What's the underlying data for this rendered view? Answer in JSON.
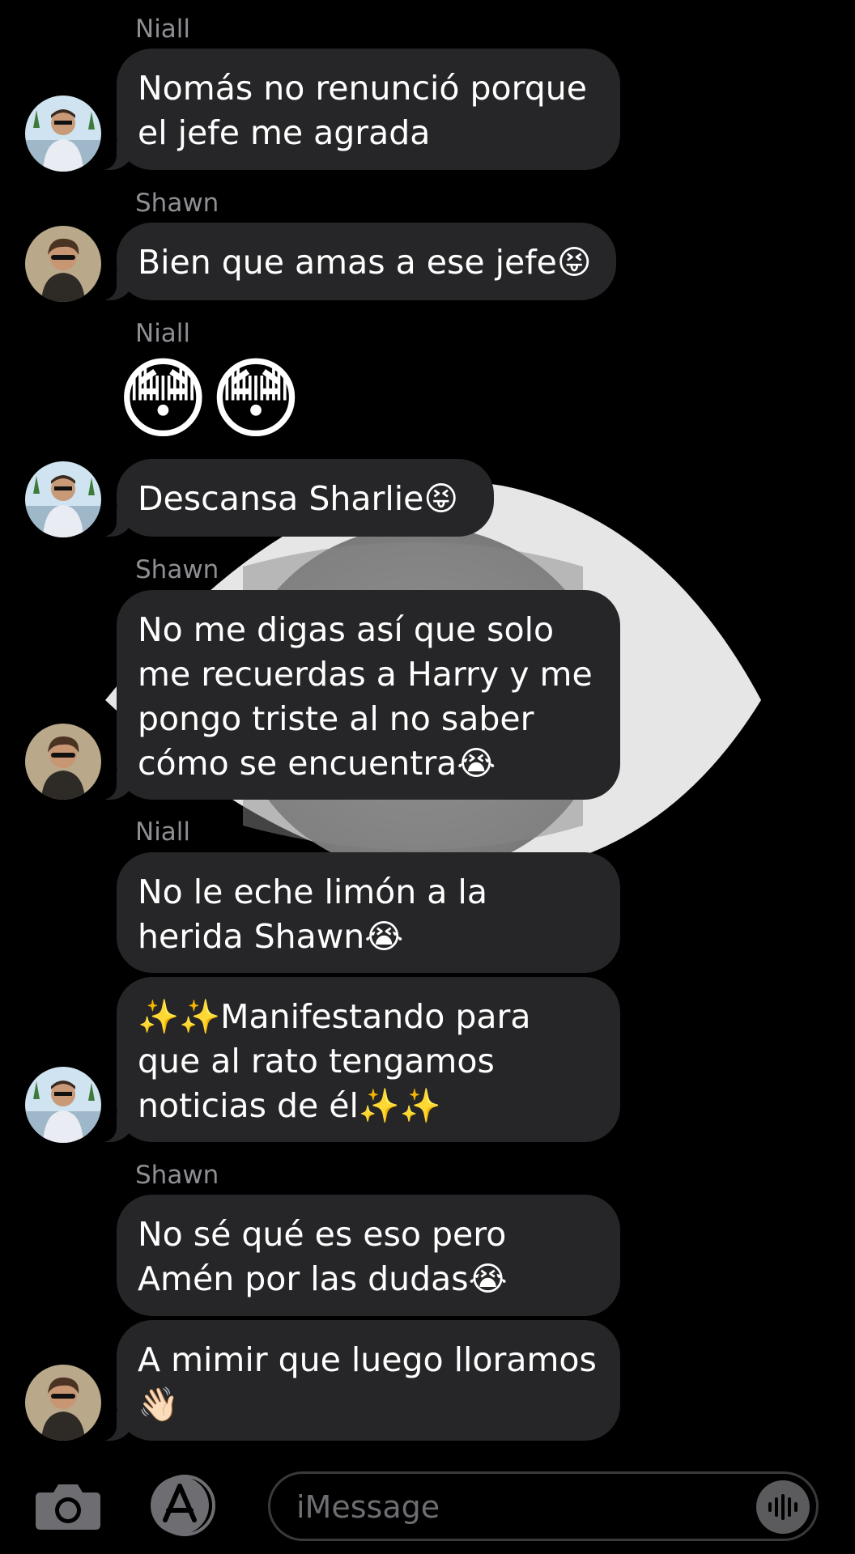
{
  "colors": {
    "background": "#000000",
    "bubble": "#262628",
    "sender_name": "#8e8e93",
    "text": "#ffffff"
  },
  "messages": [
    {
      "sender": "Niall",
      "text": "Nomás no renunció porque el jefe me agrada"
    },
    {
      "sender": "Shawn",
      "text": "Bien que amas a ese jefe😝"
    },
    {
      "sender": "Niall",
      "emoji": "😳😳"
    },
    {
      "sender": "",
      "text": "Descansa Sharlie😝"
    },
    {
      "sender": "Shawn",
      "text": "No me digas así que solo me recuerdas a Harry y me pongo triste al no saber cómo se encuentra😭"
    },
    {
      "sender": "Niall",
      "text": "No le eche limón a la herida Shawn😭"
    },
    {
      "sender": "",
      "text": "✨✨Manifestando para que al rato tengamos noticias de él✨✨"
    },
    {
      "sender": "Shawn",
      "text": "No sé qué es eso pero Amén por las dudas😭"
    },
    {
      "sender": "",
      "text": "A mimir que luego lloramos 👋🏻"
    }
  ],
  "input": {
    "placeholder": "iMessage",
    "camera_icon": "camera-icon",
    "apps_icon": "app-store-icon",
    "audio_icon": "audio-waveform-icon"
  }
}
